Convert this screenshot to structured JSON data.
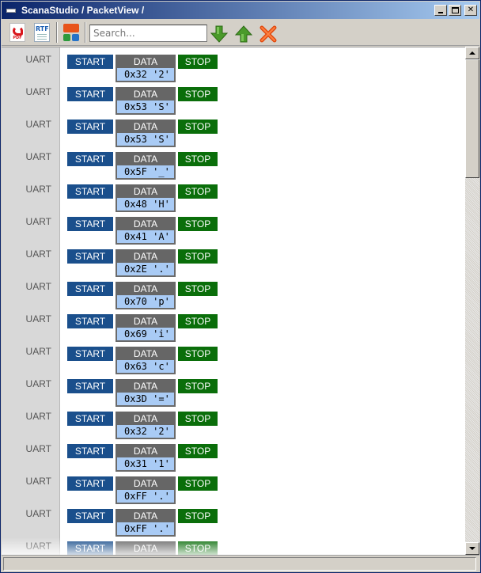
{
  "window": {
    "title": "ScanaStudio / PacketView /",
    "app_icon_label": "ScanaStudio"
  },
  "toolbar": {
    "pdf_label": "PDF",
    "rtf_label": "RTF",
    "search_placeholder": "Search...",
    "search_value": ""
  },
  "packets": [
    {
      "proto": "UART",
      "start": "START",
      "data": "DATA",
      "value": "0x32 '2'",
      "stop": "STOP"
    },
    {
      "proto": "UART",
      "start": "START",
      "data": "DATA",
      "value": "0x53 'S'",
      "stop": "STOP"
    },
    {
      "proto": "UART",
      "start": "START",
      "data": "DATA",
      "value": "0x53 'S'",
      "stop": "STOP"
    },
    {
      "proto": "UART",
      "start": "START",
      "data": "DATA",
      "value": "0x5F '_'",
      "stop": "STOP"
    },
    {
      "proto": "UART",
      "start": "START",
      "data": "DATA",
      "value": "0x48 'H'",
      "stop": "STOP"
    },
    {
      "proto": "UART",
      "start": "START",
      "data": "DATA",
      "value": "0x41 'A'",
      "stop": "STOP"
    },
    {
      "proto": "UART",
      "start": "START",
      "data": "DATA",
      "value": "0x2E '.'",
      "stop": "STOP"
    },
    {
      "proto": "UART",
      "start": "START",
      "data": "DATA",
      "value": "0x70 'p'",
      "stop": "STOP"
    },
    {
      "proto": "UART",
      "start": "START",
      "data": "DATA",
      "value": "0x69 'i'",
      "stop": "STOP"
    },
    {
      "proto": "UART",
      "start": "START",
      "data": "DATA",
      "value": "0x63 'c'",
      "stop": "STOP"
    },
    {
      "proto": "UART",
      "start": "START",
      "data": "DATA",
      "value": "0x3D '='",
      "stop": "STOP"
    },
    {
      "proto": "UART",
      "start": "START",
      "data": "DATA",
      "value": "0x32 '2'",
      "stop": "STOP"
    },
    {
      "proto": "UART",
      "start": "START",
      "data": "DATA",
      "value": "0x31 '1'",
      "stop": "STOP"
    },
    {
      "proto": "UART",
      "start": "START",
      "data": "DATA",
      "value": "0xFF '.'",
      "stop": "STOP"
    },
    {
      "proto": "UART",
      "start": "START",
      "data": "DATA",
      "value": "0xFF '.'",
      "stop": "STOP"
    },
    {
      "proto": "UART",
      "start": "START",
      "data": "DATA",
      "value": "",
      "stop": "STOP"
    }
  ],
  "colors": {
    "start": "#1a4f8c",
    "data_header": "#666666",
    "data_value": "#a9cbf5",
    "stop": "#0a6e0a"
  },
  "scrollbar": {
    "position": 0
  }
}
